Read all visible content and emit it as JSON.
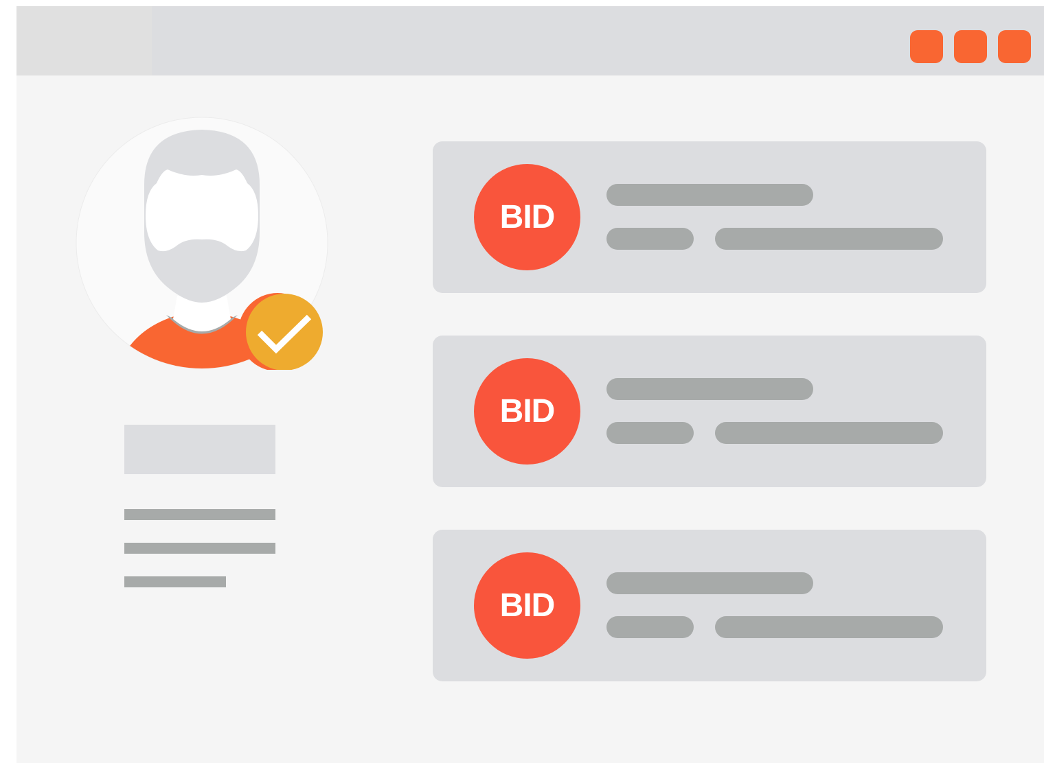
{
  "window": {
    "controls": [
      "window-control-1",
      "window-control-2",
      "window-control-3"
    ]
  },
  "profile": {
    "verified": true
  },
  "bids": [
    {
      "badge": "BID"
    },
    {
      "badge": "BID"
    },
    {
      "badge": "BID"
    }
  ],
  "colors": {
    "accent": "#f96632",
    "bid_badge": "#f9553c",
    "verified_badge": "#eeab2f",
    "placeholder_dark": "#a7aaa9",
    "placeholder_light": "#dcdde0",
    "background": "#f5f5f5"
  }
}
